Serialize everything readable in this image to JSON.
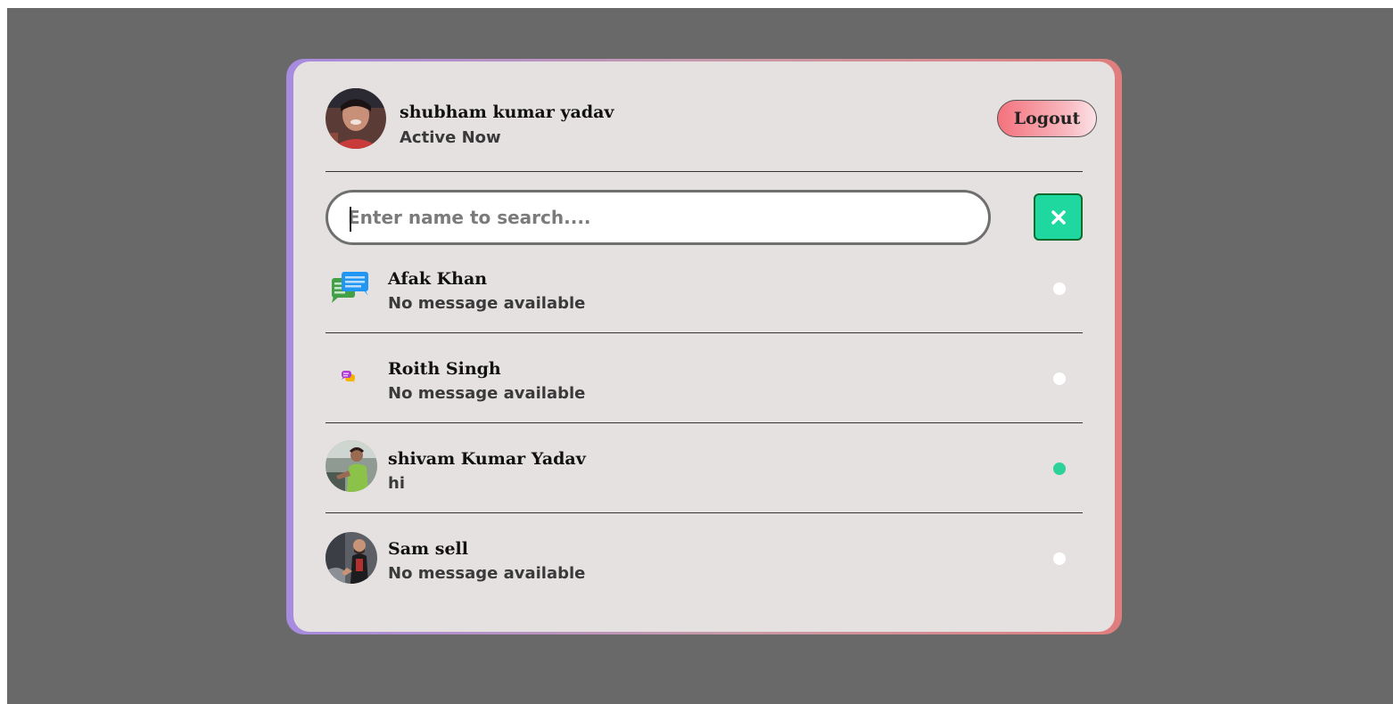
{
  "user": {
    "name": "shubham kumar yadav",
    "status": "Active Now"
  },
  "header": {
    "logout_label": "Logout"
  },
  "search": {
    "placeholder": "Enter name to search....",
    "value": ""
  },
  "colors": {
    "online": "#2dd19a",
    "offline": "#ffffff",
    "clear_button": "#1ed89f",
    "card_bg": "#e6e1e1",
    "backdrop": "#696969"
  },
  "chats": [
    {
      "name": "Afak Khan",
      "last_message": "No message available",
      "online": false,
      "icon": "chat-bubbles-icon"
    },
    {
      "name": "Roith Singh",
      "last_message": "No message available",
      "online": false,
      "icon": "chat-bubbles-small-icon"
    },
    {
      "name": "shivam Kumar Yadav",
      "last_message": "hi",
      "online": true,
      "icon": "avatar-photo"
    },
    {
      "name": "Sam sell",
      "last_message": "No message available",
      "online": false,
      "icon": "avatar-photo"
    }
  ]
}
